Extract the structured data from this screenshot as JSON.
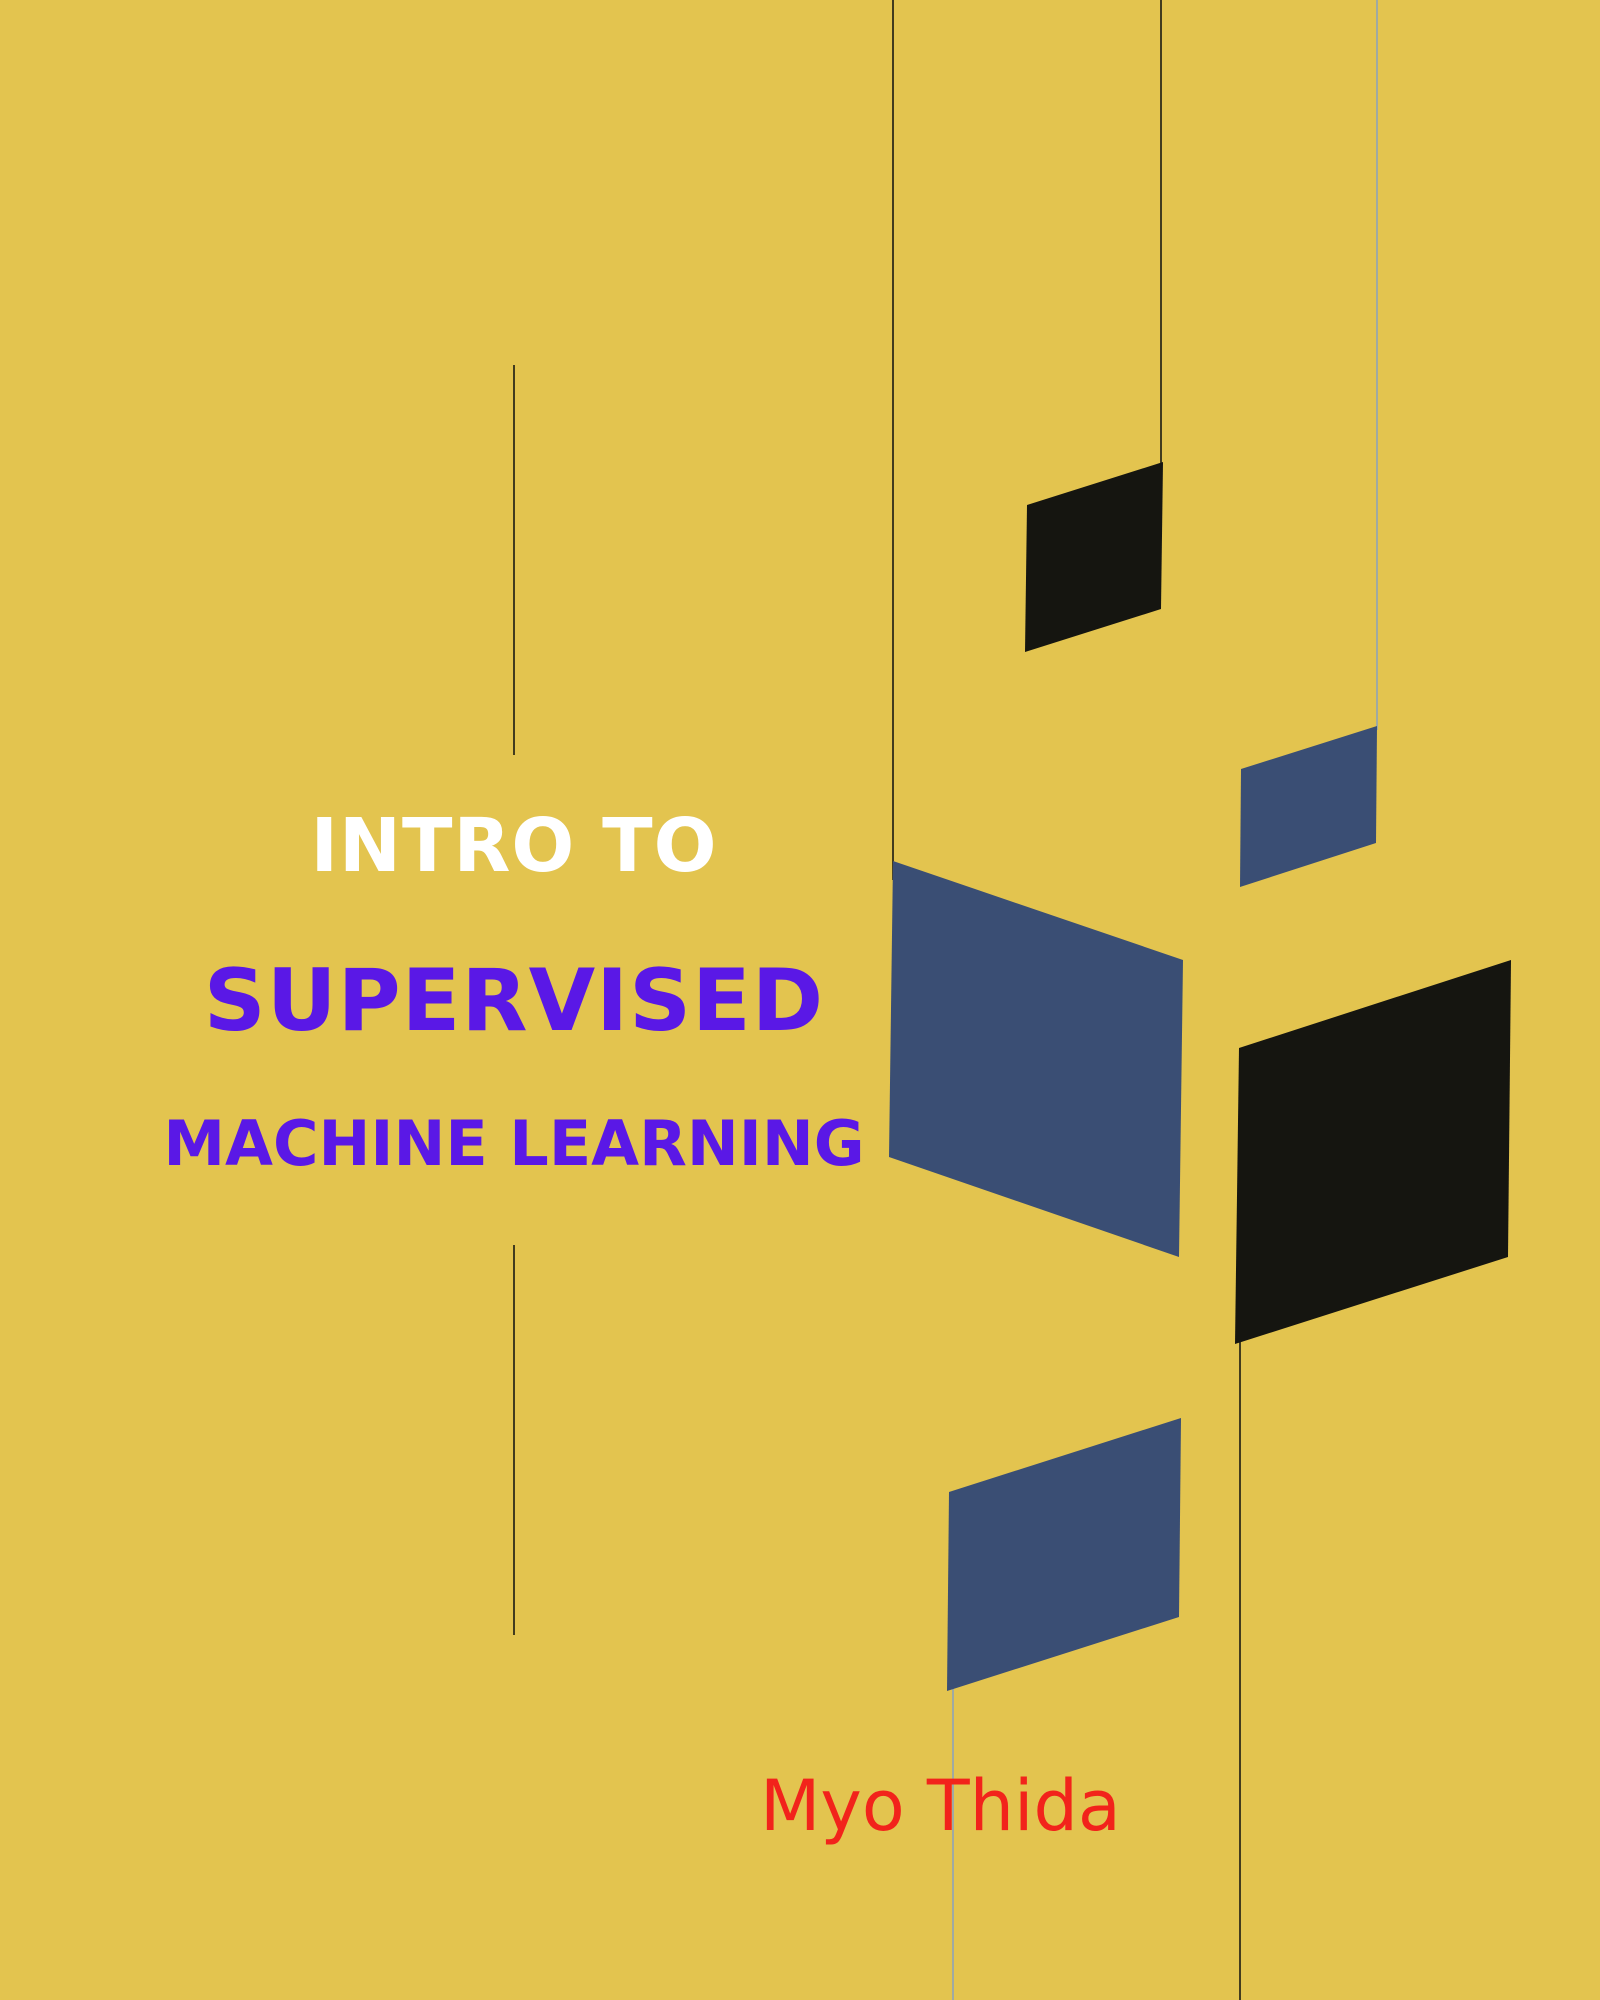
{
  "cover": {
    "title_line_1": "INTRO TO",
    "title_line_2": "SUPERVISED",
    "title_line_3": "MACHINE LEARNING",
    "author": "Myo Thida"
  },
  "colors": {
    "background": "#E3C44F",
    "title_line_1": "#FFFFFF",
    "title_accent": "#5A18E6",
    "author": "#F2231B",
    "navy_shape": "#3A4E74",
    "black_shape": "#151510",
    "line_dark": "#1A1A12",
    "line_light": "#8FA4B8"
  }
}
